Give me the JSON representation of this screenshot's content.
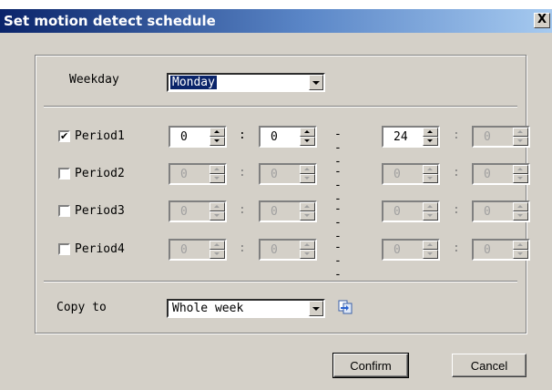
{
  "window": {
    "title": "Set motion detect schedule",
    "close_label": "X"
  },
  "weekday": {
    "label": "Weekday",
    "value": "Monday"
  },
  "periods": [
    {
      "label": "Period1",
      "checked": true,
      "start_hour": "0",
      "start_min": "0",
      "end_hour": "24",
      "end_min": "0"
    },
    {
      "label": "Period2",
      "checked": false,
      "start_hour": "0",
      "start_min": "0",
      "end_hour": "0",
      "end_min": "0"
    },
    {
      "label": "Period3",
      "checked": false,
      "start_hour": "0",
      "start_min": "0",
      "end_hour": "0",
      "end_min": "0"
    },
    {
      "label": "Period4",
      "checked": false,
      "start_hour": "0",
      "start_min": "0",
      "end_hour": "0",
      "end_min": "0"
    }
  ],
  "separators": {
    "colon": ":",
    "dash": "---"
  },
  "copy": {
    "label": "Copy to",
    "value": "Whole week",
    "icon": "copy-icon"
  },
  "buttons": {
    "confirm": "Confirm",
    "cancel": "Cancel"
  },
  "colors": {
    "title_bar_start": "#0a246a",
    "title_bar_end": "#a6caf0",
    "dialog_face": "#d4d0c8",
    "selection": "#0a246a"
  }
}
